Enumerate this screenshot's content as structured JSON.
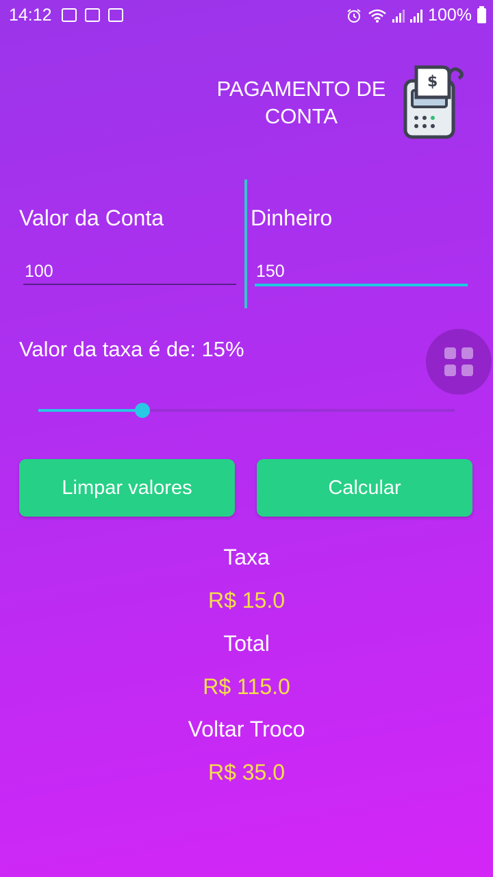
{
  "status_bar": {
    "time": "14:12",
    "battery": "100%",
    "icons": [
      "image-icon",
      "voicemail-1-icon",
      "voicemail-2-icon",
      "alarm-icon",
      "wifi-icon",
      "signal-icon",
      "signal-icon",
      "battery-icon"
    ]
  },
  "header": {
    "title": "PAGAMENTO DE CONTA",
    "icon": "pos-terminal-icon"
  },
  "form": {
    "bill_label": "Valor da Conta",
    "bill_value": "100",
    "cash_label": "Dinheiro",
    "cash_value": "150",
    "rate_label": "Valor da taxa é de: 15%",
    "slider_fraction": 0.25
  },
  "buttons": {
    "clear": "Limpar valores",
    "calculate": "Calcular"
  },
  "results": {
    "fee_label": "Taxa",
    "fee_value": "R$ 15.0",
    "total_label": "Total",
    "total_value": "R$ 115.0",
    "change_label": "Voltar Troco",
    "change_value": "R$ 35.0"
  },
  "colors": {
    "accent": "#26d086",
    "money": "#f3e049",
    "slider": "#29c8e4"
  }
}
